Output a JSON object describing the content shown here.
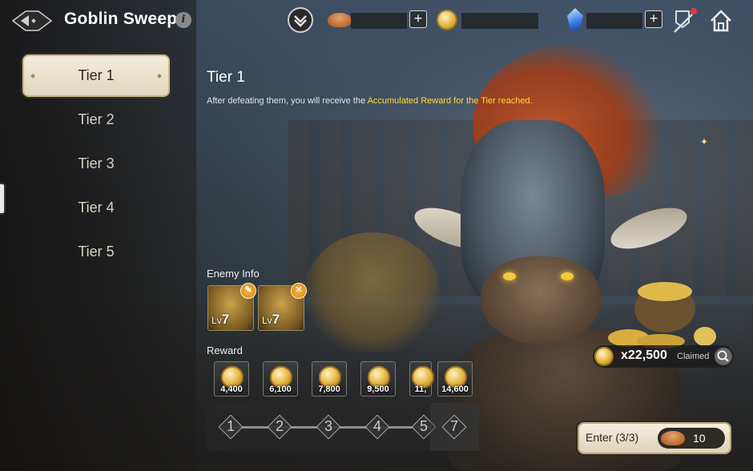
{
  "header": {
    "title": "Goblin Sweep",
    "info_icon": "info-icon",
    "stamina_value": "",
    "gold_value": "",
    "crystal_value": ""
  },
  "sidebar": {
    "tiers": [
      {
        "label": "Tier 1",
        "selected": true
      },
      {
        "label": "Tier 2",
        "selected": false
      },
      {
        "label": "Tier 3",
        "selected": false
      },
      {
        "label": "Tier 4",
        "selected": false
      },
      {
        "label": "Tier 5",
        "selected": false
      }
    ]
  },
  "main": {
    "tier_title": "Tier 1",
    "description_prefix": "After defeating them, you will receive the ",
    "description_highlight": "Accumulated Reward for the Tier reached.",
    "enemy_info_label": "Enemy Info",
    "enemies": [
      {
        "lv_prefix": "Lv",
        "level": "7",
        "badge_icon": "pencil-icon"
      },
      {
        "lv_prefix": "Lv",
        "level": "7",
        "badge_icon": "cross-icon"
      }
    ],
    "reward_label": "Reward",
    "rewards": [
      "4,400",
      "6,100",
      "7,800",
      "9,500",
      "11,",
      "14,600"
    ],
    "progress_steps": [
      "1",
      "2",
      "3",
      "4",
      "5",
      "7"
    ]
  },
  "accumulated": {
    "amount": "x22,500",
    "status": "Claimed"
  },
  "enter": {
    "label": "Enter (3/3)",
    "cost": "10"
  },
  "colors": {
    "highlight": "#ffd83a",
    "button_cream": "#f3ecdb",
    "hair_orange": "#d0531f"
  }
}
